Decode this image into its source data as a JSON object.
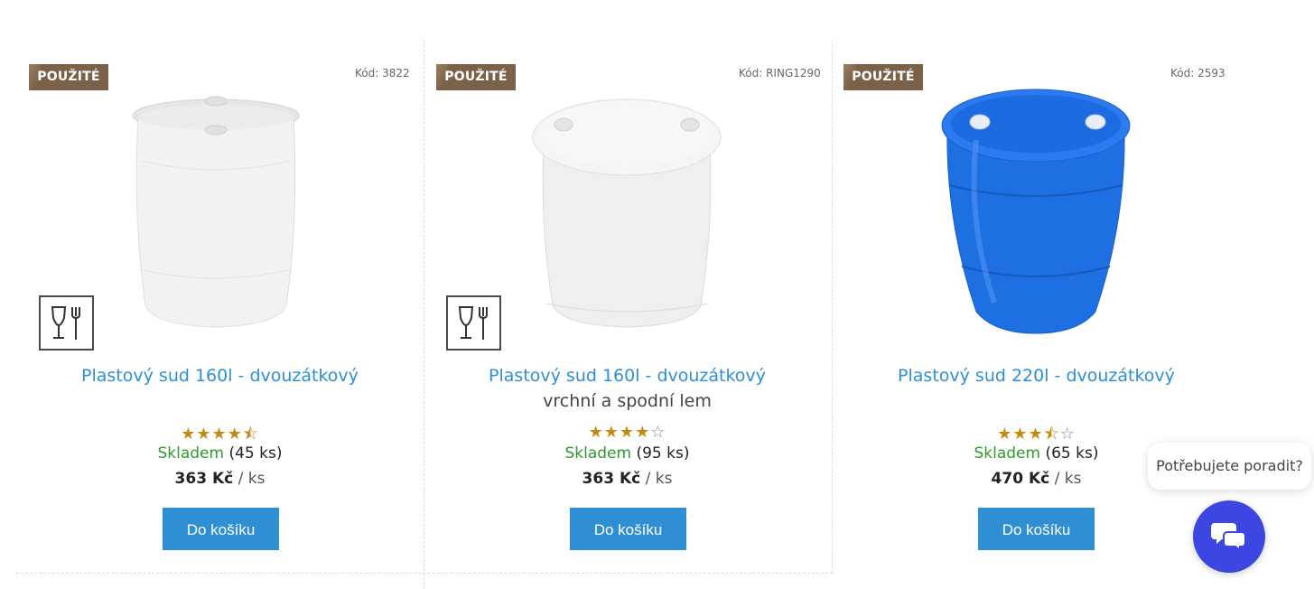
{
  "products": [
    {
      "badge": "POUŽITÉ",
      "code": "Kód: 3822",
      "title": "Plastový sud 160l - dvouzátkový",
      "subtitle": "",
      "rating": 4.5,
      "stars": "★★★★⯪",
      "stock_label": "Skladem",
      "stock_count": "(45 ks)",
      "price": "363 Kč",
      "unit": "/ ks",
      "button": "Do košíku",
      "food_icon": "food-safe-icon",
      "barrel_color": "#f1f1f1"
    },
    {
      "badge": "POUŽITÉ",
      "code": "Kód: RING1290",
      "title": "Plastový sud 160l - dvouzátkový",
      "subtitle": "vrchní a spodní lem",
      "rating": 4,
      "stars": "★★★★☆",
      "stock_label": "Skladem",
      "stock_count": "(95 ks)",
      "price": "363 Kč",
      "unit": "/ ks",
      "button": "Do košíku",
      "food_icon": "food-safe-icon",
      "barrel_color": "#ededed"
    },
    {
      "badge": "POUŽITÉ",
      "code": "Kód: 2593",
      "title": "Plastový sud 220l - dvouzátkový",
      "subtitle": "",
      "rating": 3.5,
      "stars": "★★★⯪☆",
      "stock_label": "Skladem",
      "stock_count": "(65 ks)",
      "price": "470 Kč",
      "unit": "/ ks",
      "button": "Do košíku",
      "food_icon": "",
      "barrel_color": "#1f6fe0"
    }
  ],
  "help": {
    "bubble": "Potřebujete poradit?",
    "chat_icon": "chat-icon"
  },
  "colors": {
    "badge": "#7b6148",
    "accent": "#2f8fd5",
    "stock": "#2e9a2e",
    "star": "#c38a14",
    "chat": "#3b47e0"
  }
}
